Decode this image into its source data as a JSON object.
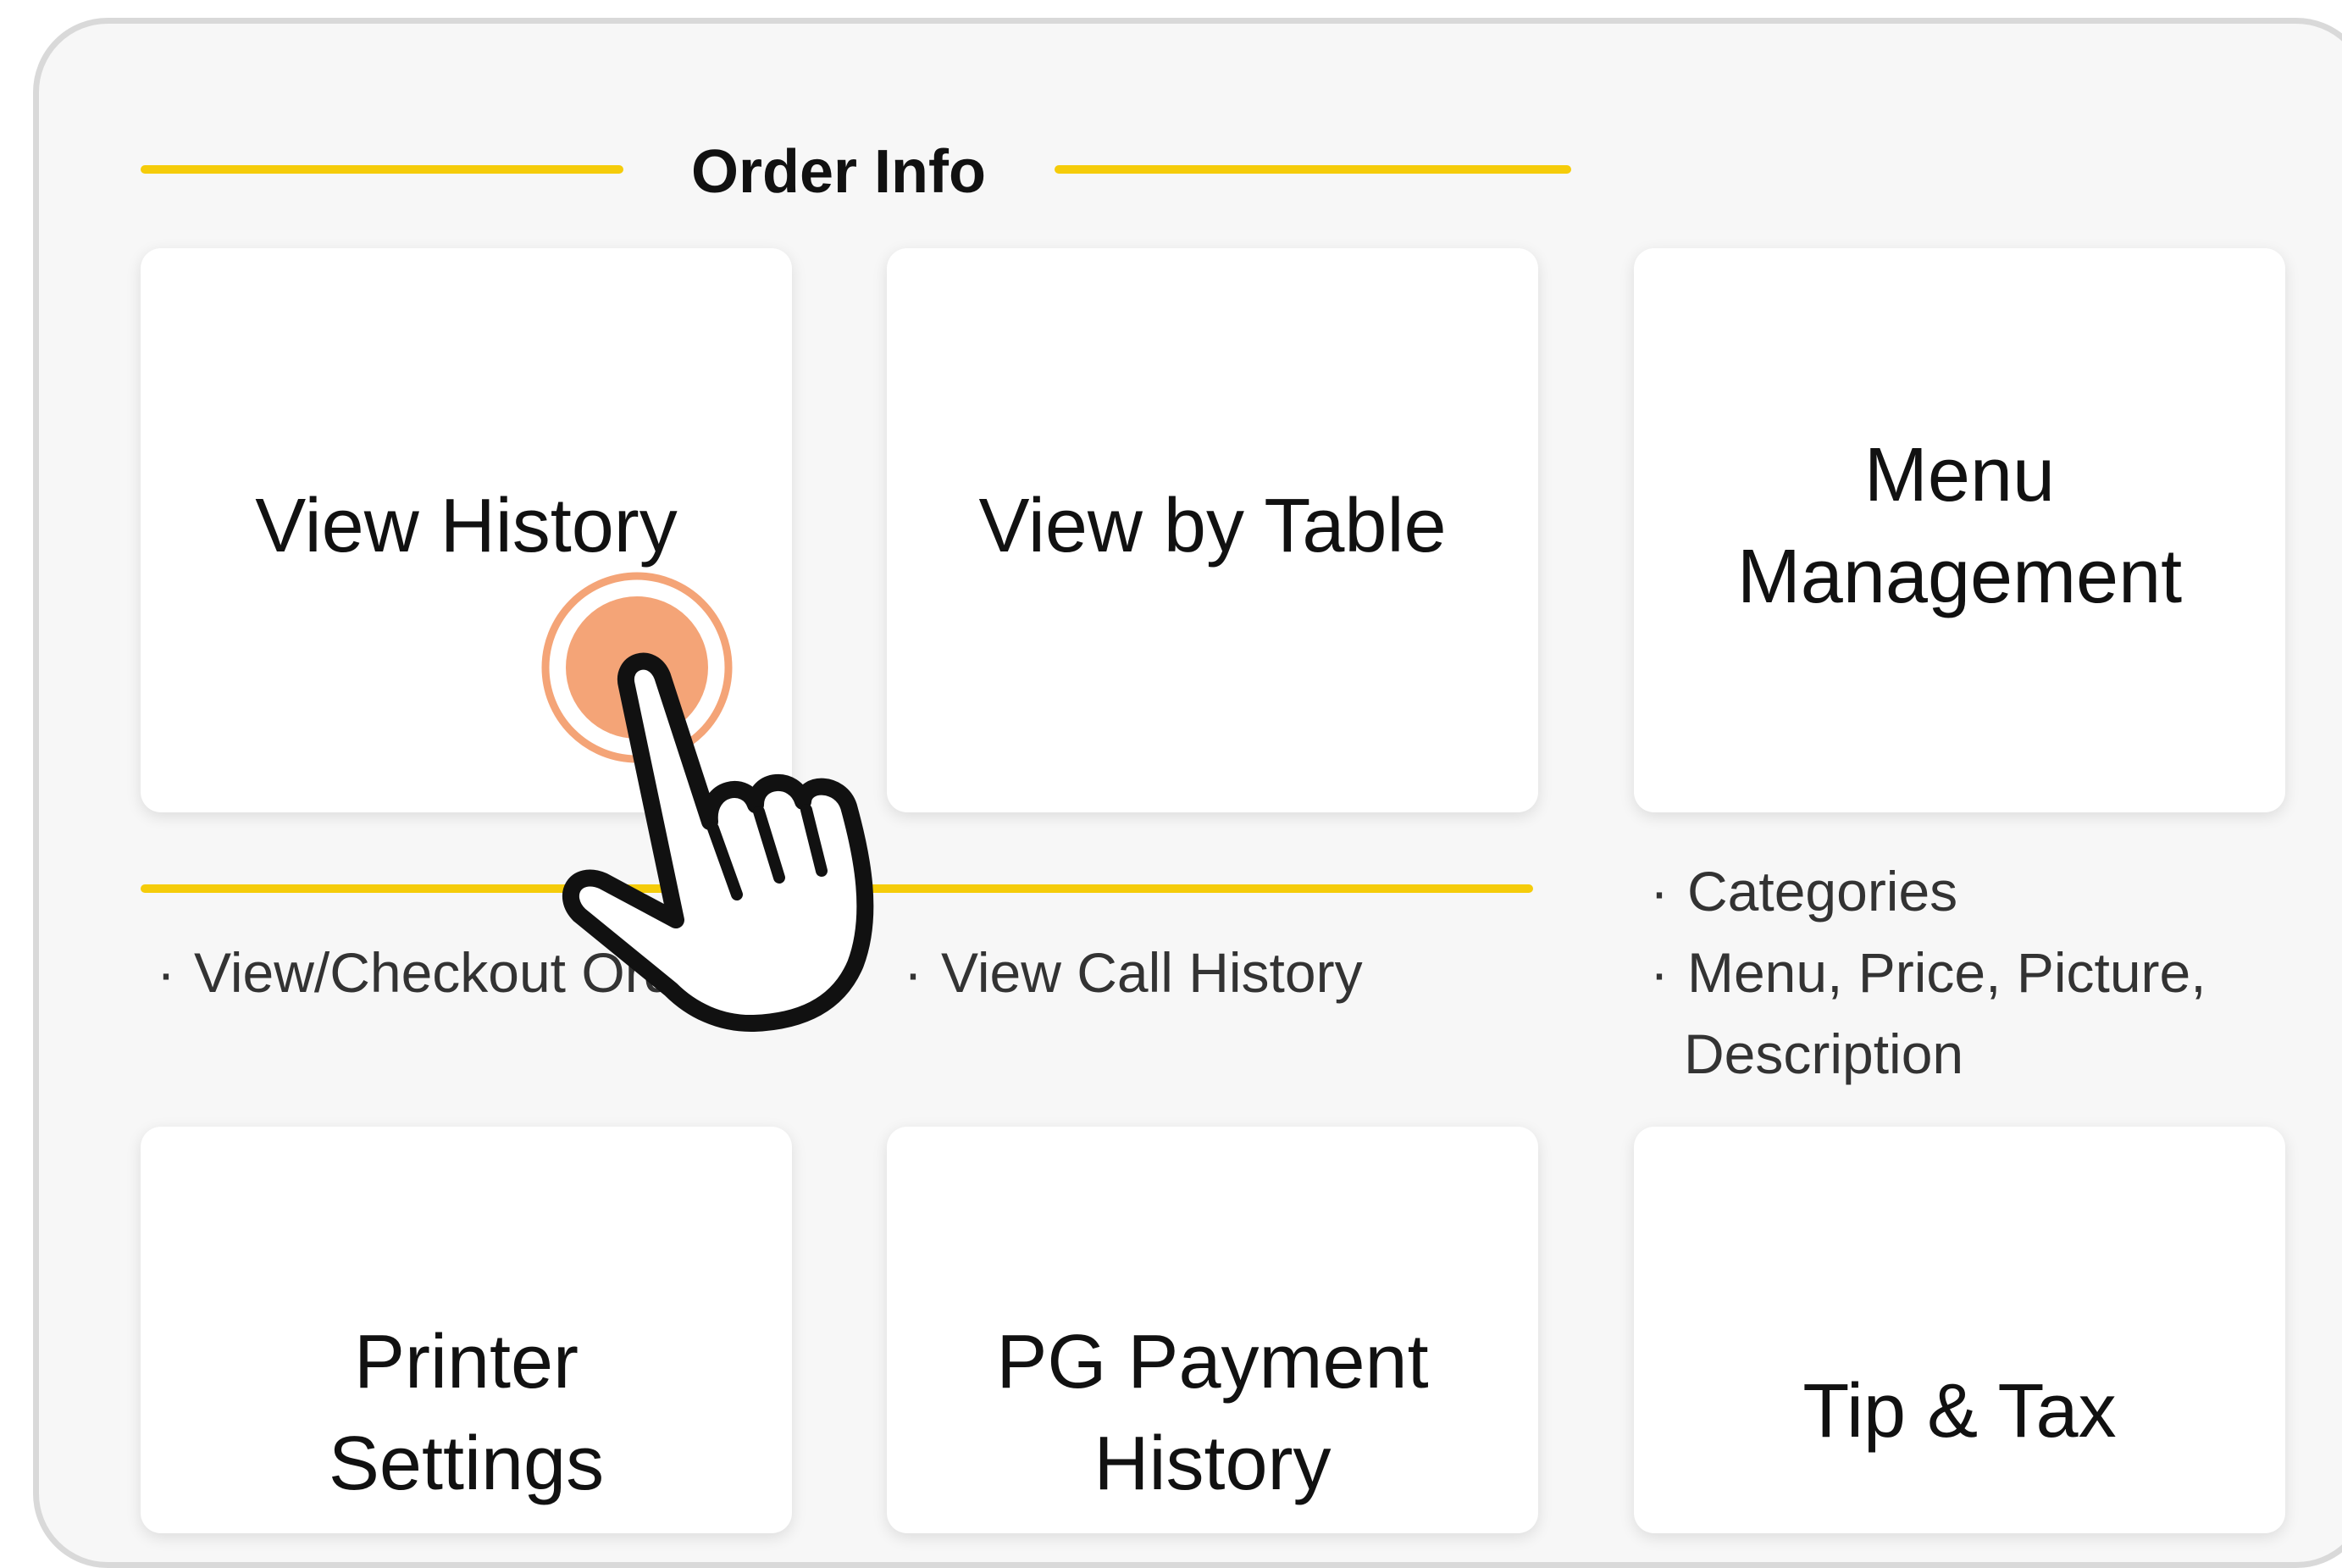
{
  "section": {
    "title": "Order Info"
  },
  "cards": {
    "view_history": "View History",
    "view_by_table": "View by Table",
    "menu_management": "Menu\nManagement",
    "printer_settings": "Printer\nSettings",
    "pg_payment_history": "PG Payment\nHistory",
    "tip_tax": "Tip & Tax"
  },
  "descriptions": {
    "view_history": [
      "View/Checkout Orders"
    ],
    "view_by_table": [
      "View Call History"
    ],
    "menu_management": [
      "Categories",
      "Menu, Price, Picture,",
      "Description"
    ]
  },
  "bullet": "·",
  "colors": {
    "accent_line": "#f5cc0a",
    "tap_indicator": "#f4a477"
  },
  "icons": {
    "pointer": "tap-hand-icon"
  }
}
